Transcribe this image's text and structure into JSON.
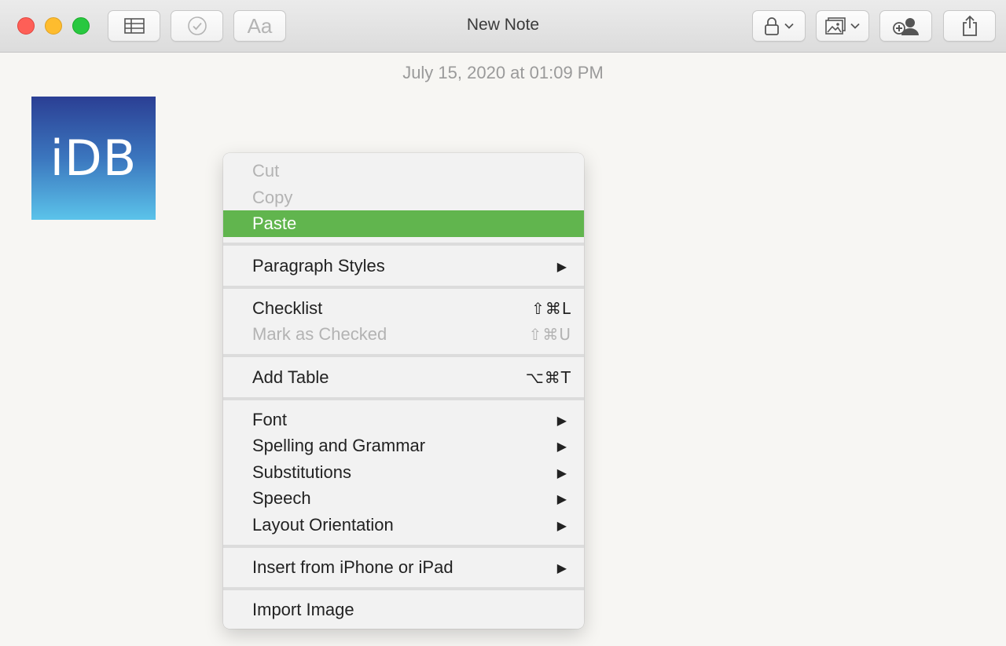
{
  "window": {
    "title": "New Note"
  },
  "note": {
    "date": "July 15, 2020 at 01:09 PM",
    "image_text": "iDB"
  },
  "colors": {
    "highlight": "#61b54e",
    "close": "#fe5f57",
    "minimize": "#febc2e",
    "zoom": "#28c840"
  },
  "toolbar": {
    "table_icon": "table-icon",
    "checklist_icon": "checklist-icon",
    "format_label": "Aa",
    "lock_icon": "lock-icon",
    "media_icon": "photo-icon",
    "collaborate_icon": "add-people-icon",
    "share_icon": "share-icon"
  },
  "context_menu": {
    "cut": "Cut",
    "copy": "Copy",
    "paste": "Paste",
    "paragraph_styles": "Paragraph Styles",
    "checklist": "Checklist",
    "checklist_shortcut": "⇧⌘L",
    "mark_as_checked": "Mark as Checked",
    "mark_as_checked_shortcut": "⇧⌘U",
    "add_table": "Add Table",
    "add_table_shortcut": "⌥⌘T",
    "font": "Font",
    "spelling_and_grammar": "Spelling and Grammar",
    "substitutions": "Substitutions",
    "speech": "Speech",
    "layout_orientation": "Layout Orientation",
    "insert_from_iphone": "Insert from iPhone or iPad",
    "import_image": "Import Image",
    "submenu_arrow": "▶"
  }
}
